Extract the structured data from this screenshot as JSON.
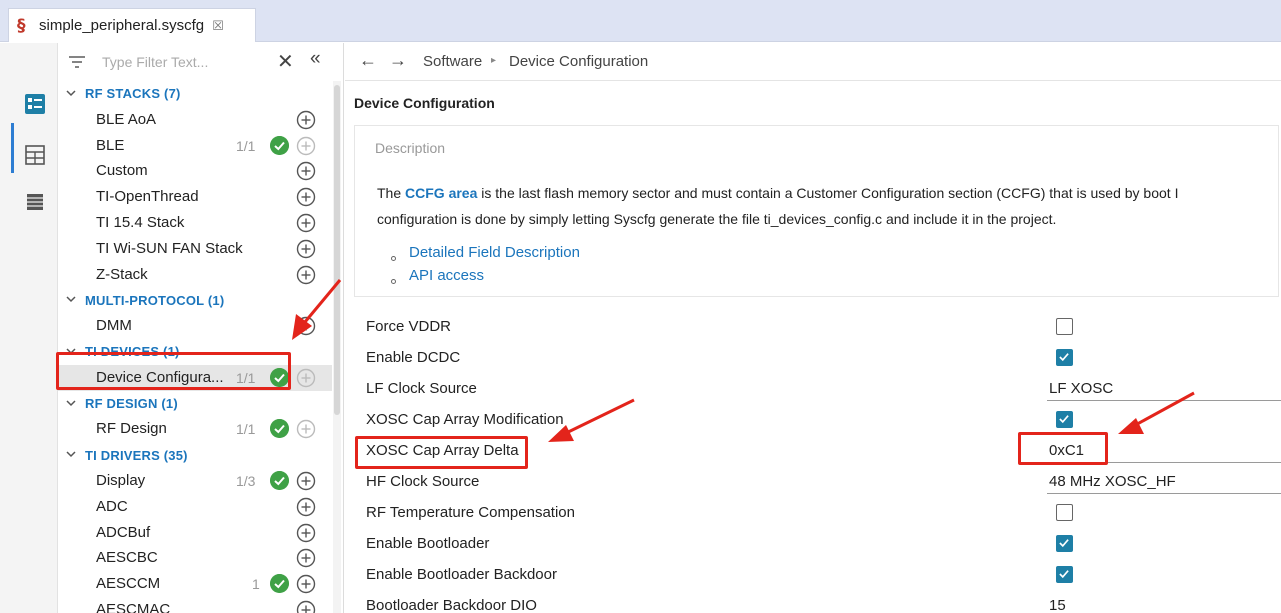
{
  "tab": {
    "title": "simple_peripheral.syscfg",
    "icon": "syscfg-icon",
    "close_glyph": "☒"
  },
  "sidebar": {
    "filter_placeholder": "Type Filter Text...",
    "clear_glyph": "✕",
    "collapse_glyph": "«",
    "categories": [
      {
        "label": "RF STACKS (7)",
        "items": [
          {
            "label": "BLE AoA",
            "count": "",
            "checked": false
          },
          {
            "label": "BLE",
            "count": "1/1",
            "checked": true,
            "add_disabled": true
          },
          {
            "label": "Custom",
            "count": "",
            "checked": false
          },
          {
            "label": "TI-OpenThread",
            "count": "",
            "checked": false
          },
          {
            "label": "TI 15.4 Stack",
            "count": "",
            "checked": false
          },
          {
            "label": "TI Wi-SUN FAN Stack",
            "count": "",
            "checked": false
          },
          {
            "label": "Z-Stack",
            "count": "",
            "checked": false
          }
        ]
      },
      {
        "label": "MULTI-PROTOCOL (1)",
        "items": [
          {
            "label": "DMM",
            "count": "",
            "checked": false
          }
        ]
      },
      {
        "label": "TI DEVICES (1)",
        "items": [
          {
            "label": "Device Configura...",
            "count": "1/1",
            "checked": true,
            "add_disabled": true,
            "selected": true
          }
        ]
      },
      {
        "label": "RF DESIGN (1)",
        "items": [
          {
            "label": "RF Design",
            "count": "1/1",
            "checked": true,
            "add_disabled": true
          }
        ]
      },
      {
        "label": "TI DRIVERS (35)",
        "items": [
          {
            "label": "Display",
            "count": "1/3",
            "checked": true
          },
          {
            "label": "ADC",
            "count": "",
            "checked": false
          },
          {
            "label": "ADCBuf",
            "count": "",
            "checked": false
          },
          {
            "label": "AESCBC",
            "count": "",
            "checked": false
          },
          {
            "label": "AESCCM",
            "count": "1",
            "checked": true
          },
          {
            "label": "AESCMAC",
            "count": "",
            "checked": false
          }
        ]
      }
    ]
  },
  "breadcrumb": {
    "back_glyph": "←",
    "forward_glyph": "→",
    "items": [
      "Software",
      "Device Configuration"
    ],
    "separator": "▸"
  },
  "main": {
    "title": "Device Configuration",
    "description": {
      "header": "Description",
      "line1_prefix": "The ",
      "line1_highlight": "CCFG area",
      "line1_rest": " is the last flash memory sector and must contain a Customer Configuration section (CCFG) that is used by boot I",
      "line2": "configuration is done by simply letting Syscfg generate the file ti_devices_config.c and include it in the project.",
      "links": [
        "Detailed Field Description",
        "API access"
      ]
    },
    "properties": [
      {
        "label": "Force VDDR",
        "type": "checkbox",
        "checked": false
      },
      {
        "label": "Enable DCDC",
        "type": "checkbox",
        "checked": true
      },
      {
        "label": "LF Clock Source",
        "type": "select",
        "value": "LF XOSC"
      },
      {
        "label": "XOSC Cap Array Modification",
        "type": "checkbox",
        "checked": true
      },
      {
        "label": "XOSC Cap Array Delta",
        "type": "text",
        "value": "0xC1"
      },
      {
        "label": "HF Clock Source",
        "type": "select",
        "value": "48 MHz XOSC_HF"
      },
      {
        "label": "RF Temperature Compensation",
        "type": "checkbox",
        "checked": false
      },
      {
        "label": "Enable Bootloader",
        "type": "checkbox",
        "checked": true
      },
      {
        "label": "Enable Bootloader Backdoor",
        "type": "checkbox",
        "checked": true
      },
      {
        "label": "Bootloader Backdoor DIO",
        "type": "text",
        "value": "15"
      }
    ]
  },
  "colors": {
    "accent_blue": "#1b75bc",
    "check_green": "#3fa146",
    "checkbox_teal": "#1e7fa6",
    "annotation_red": "#e3241b",
    "tabbar_bg": "#dde3f3"
  }
}
